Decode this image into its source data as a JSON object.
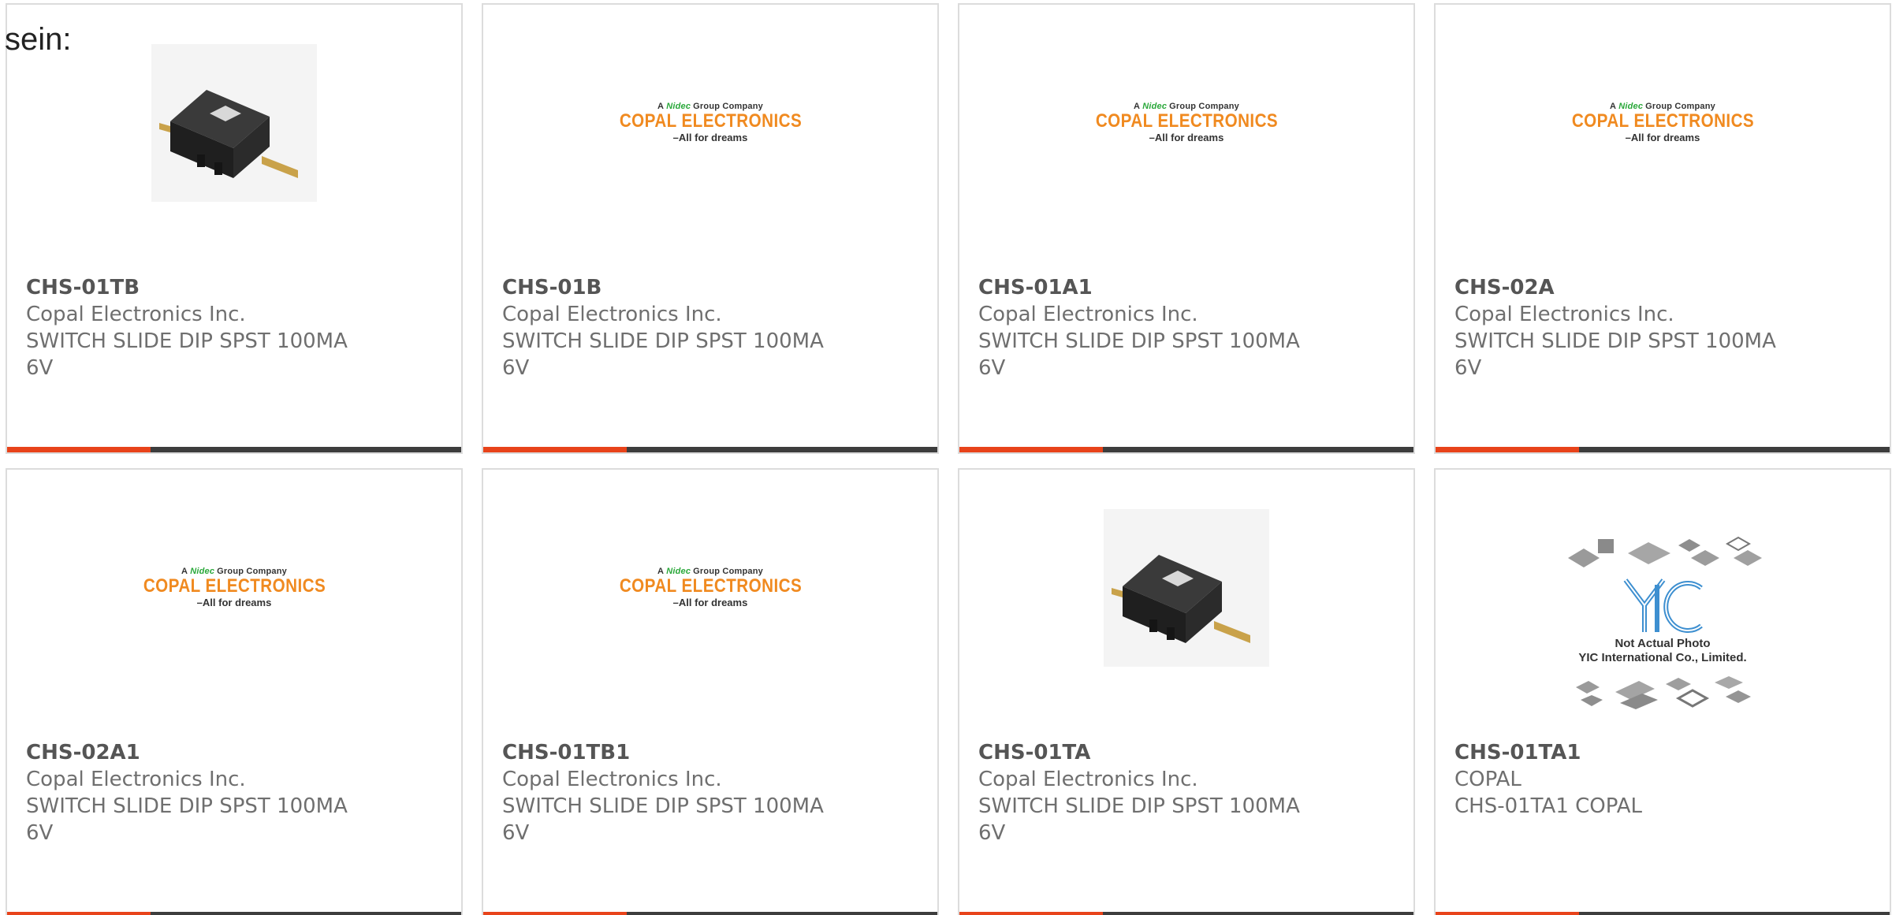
{
  "intro_text": "sein:",
  "logo": {
    "top_prefix": "A",
    "top_brand": "Nidec",
    "top_suffix": "Group Company",
    "main": "COPAL ELECTRONICS",
    "tagline": "–All for dreams"
  },
  "placeholder": {
    "line1": "Not Actual Photo",
    "line2": "YIC International Co., Limited."
  },
  "colors": {
    "accent": "#e8431a",
    "bar": "#3d3d3d",
    "logo_orange": "#f08a20"
  },
  "products": [
    {
      "part_number": "CHS-01TB",
      "manufacturer": "Copal Electronics Inc.",
      "description": "SWITCH SLIDE DIP SPST 100MA 6V",
      "image": "switch-photo-icon"
    },
    {
      "part_number": "CHS-01B",
      "manufacturer": "Copal Electronics Inc.",
      "description": "SWITCH SLIDE DIP SPST 100MA 6V",
      "image": "copal-logo"
    },
    {
      "part_number": "CHS-01A1",
      "manufacturer": "Copal Electronics Inc.",
      "description": "SWITCH SLIDE DIP SPST 100MA 6V",
      "image": "copal-logo"
    },
    {
      "part_number": "CHS-02A",
      "manufacturer": "Copal Electronics Inc.",
      "description": "SWITCH SLIDE DIP SPST 100MA 6V",
      "image": "copal-logo"
    },
    {
      "part_number": "CHS-02A1",
      "manufacturer": "Copal Electronics Inc.",
      "description": "SWITCH SLIDE DIP SPST 100MA 6V",
      "image": "copal-logo"
    },
    {
      "part_number": "CHS-01TB1",
      "manufacturer": "Copal Electronics Inc.",
      "description": "SWITCH SLIDE DIP SPST 100MA 6V",
      "image": "copal-logo"
    },
    {
      "part_number": "CHS-01TA",
      "manufacturer": "Copal Electronics Inc.",
      "description": "SWITCH SLIDE DIP SPST 100MA 6V",
      "image": "switch-photo-icon"
    },
    {
      "part_number": "CHS-01TA1",
      "manufacturer": "COPAL",
      "description": "CHS-01TA1 COPAL",
      "image": "yic-placeholder"
    }
  ]
}
